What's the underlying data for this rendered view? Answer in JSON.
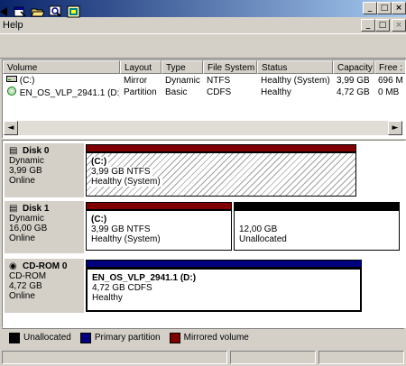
{
  "menu": {
    "help": "Help"
  },
  "window_controls": {
    "minimize": "_",
    "restore": "□",
    "close": "×"
  },
  "mdi_controls": {
    "minimize": "_",
    "restore": "□",
    "close": "×"
  },
  "toolbar": [
    "left-arrow-icon",
    "properties-icon",
    "open-folder-icon",
    "zoom-icon",
    "help-icon"
  ],
  "columns": [
    "Volume",
    "Layout",
    "Type",
    "File System",
    "Status",
    "Capacity",
    "Free :"
  ],
  "volumes": [
    {
      "icon": "drive-icon",
      "volume": "(C:)",
      "layout": "Mirror",
      "type": "Dynamic",
      "fs": "NTFS",
      "status": "Healthy (System)",
      "capacity": "3,99 GB",
      "free": "696 M"
    },
    {
      "icon": "cdrom-icon",
      "volume": "EN_OS_VLP_2941.1 (D:)",
      "layout": "Partition",
      "type": "Basic",
      "fs": "CDFS",
      "status": "Healthy",
      "capacity": "4,72 GB",
      "free": "0 MB"
    }
  ],
  "scroll": {
    "left": "◄",
    "right": "►"
  },
  "disks": [
    {
      "name": "Disk 0",
      "kind": "Dynamic",
      "size": "3,99 GB",
      "state": "Online",
      "partitions": [
        {
          "title": "(C:)",
          "detail": "3,99 GB NTFS",
          "status": "Healthy (System)",
          "color": "#800000"
        }
      ]
    },
    {
      "name": "Disk 1",
      "kind": "Dynamic",
      "size": "16,00 GB",
      "state": "Online",
      "partitions": [
        {
          "title": "(C:)",
          "detail": "3,99 GB NTFS",
          "status": "Healthy (System)",
          "color": "#800000"
        },
        {
          "title": "",
          "detail": "12,00 GB",
          "status": "Unallocated",
          "color": "#000000"
        }
      ]
    },
    {
      "name": "CD-ROM 0",
      "kind": "CD-ROM",
      "size": "4,72 GB",
      "state": "Online",
      "partitions": [
        {
          "title": "EN_OS_VLP_2941.1 (D:)",
          "detail": "4,72 GB CDFS",
          "status": "Healthy",
          "color": "#00007f"
        }
      ]
    }
  ],
  "legend": [
    {
      "label": "Unallocated",
      "color": "#000000"
    },
    {
      "label": "Primary partition",
      "color": "#00007f"
    },
    {
      "label": "Mirrored volume",
      "color": "#800000"
    }
  ]
}
